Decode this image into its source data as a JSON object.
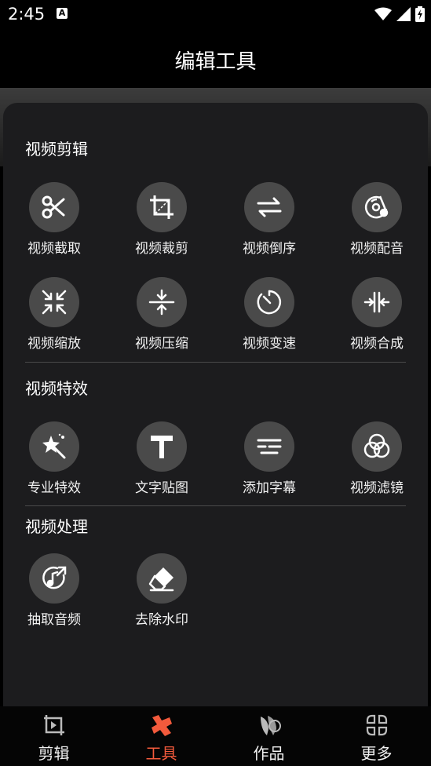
{
  "status_bar": {
    "time": "2:45",
    "notification": "A"
  },
  "header": {
    "title": "编辑工具"
  },
  "sections": [
    {
      "title": "视频剪辑",
      "tools": [
        {
          "label": "视频截取",
          "icon": "scissors-icon"
        },
        {
          "label": "视频裁剪",
          "icon": "crop-icon"
        },
        {
          "label": "视频倒序",
          "icon": "swap-arrows-icon"
        },
        {
          "label": "视频配音",
          "icon": "dubbing-disc-icon"
        },
        {
          "label": "视频缩放",
          "icon": "scale-arrows-icon"
        },
        {
          "label": "视频压缩",
          "icon": "compress-icon"
        },
        {
          "label": "视频变速",
          "icon": "speed-timer-icon"
        },
        {
          "label": "视频合成",
          "icon": "merge-icon"
        }
      ]
    },
    {
      "title": "视频特效",
      "tools": [
        {
          "label": "专业特效",
          "icon": "magic-wand-icon"
        },
        {
          "label": "文字贴图",
          "icon": "text-t-icon"
        },
        {
          "label": "添加字幕",
          "icon": "subtitle-lines-icon"
        },
        {
          "label": "视频滤镜",
          "icon": "filter-circles-icon"
        }
      ]
    },
    {
      "title": "视频处理",
      "tools": [
        {
          "label": "抽取音频",
          "icon": "music-extract-icon"
        },
        {
          "label": "去除水印",
          "icon": "eraser-icon"
        }
      ]
    }
  ],
  "bottom_nav": [
    {
      "label": "剪辑",
      "icon": "edit-frame-icon",
      "active": false
    },
    {
      "label": "工具",
      "icon": "tools-icon",
      "active": true
    },
    {
      "label": "作品",
      "icon": "works-icon",
      "active": false
    },
    {
      "label": "更多",
      "icon": "more-grid-icon",
      "active": false
    }
  ],
  "colors": {
    "accent": "#f35a3c",
    "panel": "#1c1c1e",
    "icon_circle": "#4a4a4a"
  }
}
